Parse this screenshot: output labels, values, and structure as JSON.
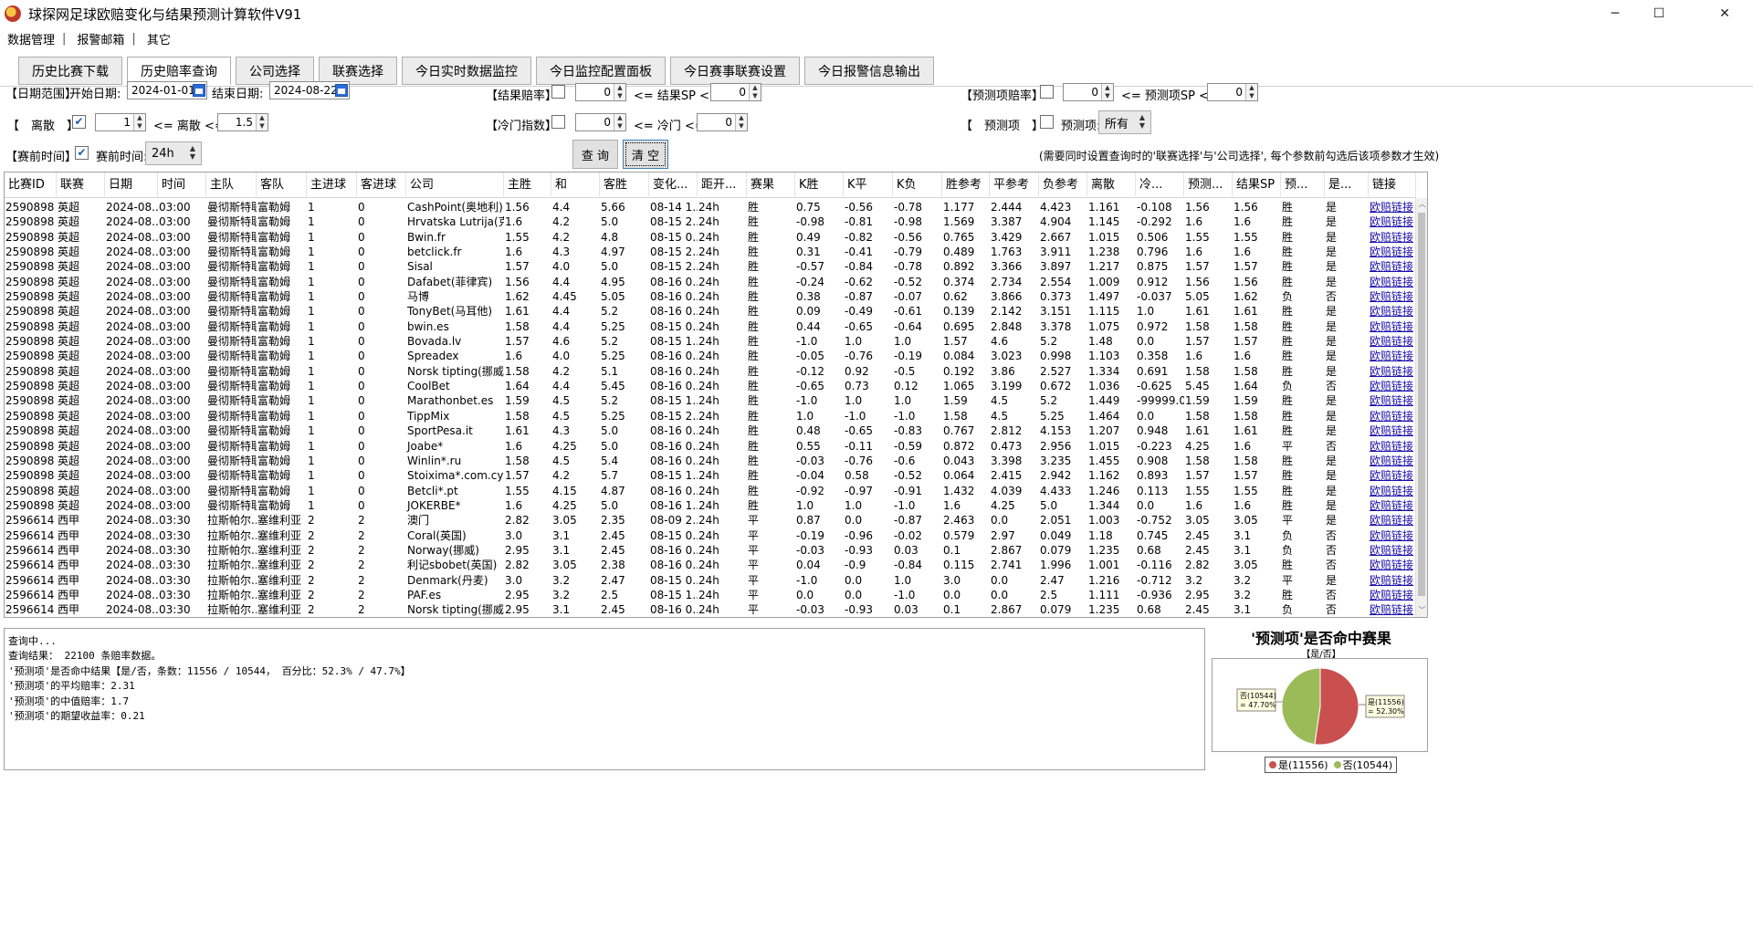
{
  "app": {
    "title": "球探网足球欧赔变化与结果预测计算软件V91",
    "min_glyph": "─",
    "max_glyph": "☐",
    "close_glyph": "✕"
  },
  "menu": {
    "items": [
      "数据管理",
      "报警邮箱",
      "其它"
    ],
    "separator": "|"
  },
  "tabs": [
    "历史比赛下载",
    "历史赔率查询",
    "公司选择",
    "联赛选择",
    "今日实时数据监控",
    "今日监控配置面板",
    "今日赛事联赛设置",
    "今日报警信息输出"
  ],
  "active_tab": 1,
  "filters": {
    "date_range_label": "【日期范围】",
    "start_label": "开始日期:",
    "start_value": "2024-01-01",
    "end_label": "结束日期:",
    "end_value": "2024-08-22",
    "disperse_label": "【　离散　】",
    "disperse_checked": true,
    "disperse_min": "1",
    "disperse_op": "<= 离散 <=",
    "disperse_max": "1.5",
    "pregame_label": "【赛前时间】",
    "pregame_checked": true,
    "pregame_time_label": "赛前时间:",
    "pregame_value": "24h",
    "result_odds_label": "【结果赔率】",
    "result_odds_min": "0",
    "result_odds_op": "<= 结果SP <=",
    "result_odds_max": "0",
    "cold_label": "【冷门指数】",
    "cold_min": "0",
    "cold_op": "<= 冷门 <=",
    "cold_max": "0",
    "pred_odds_label": "【预测项赔率】",
    "pred_odds_min": "0",
    "pred_odds_op": "<= 预测项SP <=",
    "pred_odds_max": "0",
    "pred_item_label": "【　预测项　】",
    "pred_item_text": "预测项:",
    "pred_item_value": "所有",
    "query_button": "查 询",
    "clear_button": "清 空",
    "note": "(需要同时设置查询时的'联赛选择'与'公司选择', 每个参数前勾选后该项参数才生效)"
  },
  "table": {
    "columns": [
      "比赛ID",
      "联赛",
      "日期",
      "时间",
      "主队",
      "客队",
      "主进球",
      "客进球",
      "公司",
      "主胜",
      "和",
      "客胜",
      "变化...",
      "距开...",
      "赛果",
      "K胜",
      "K平",
      "K负",
      "胜参考",
      "平参考",
      "负参考",
      "离散",
      "冷...",
      "预测...",
      "结果SP",
      "预...",
      "是...",
      "链接"
    ],
    "rows": [
      [
        "2590898",
        "英超",
        "2024-08...",
        "03:00",
        "曼彻斯特联",
        "富勒姆",
        "1",
        "0",
        "CashPoint(奥地利)",
        "1.56",
        "4.4",
        "5.66",
        "08-14 1...",
        "24h",
        "胜",
        "0.75",
        "-0.56",
        "-0.78",
        "1.177",
        "2.444",
        "4.423",
        "1.161",
        "-0.108",
        "1.56",
        "1.56",
        "胜",
        "是",
        "欧赔链接"
      ],
      [
        "2590898",
        "英超",
        "2024-08...",
        "03:00",
        "曼彻斯特联",
        "富勒姆",
        "1",
        "0",
        "Hrvatska Lutrija(克...",
        "1.6",
        "4.2",
        "5.0",
        "08-15 2...",
        "24h",
        "胜",
        "-0.98",
        "-0.81",
        "-0.98",
        "1.569",
        "3.387",
        "4.904",
        "1.145",
        "-0.292",
        "1.6",
        "1.6",
        "胜",
        "是",
        "欧赔链接"
      ],
      [
        "2590898",
        "英超",
        "2024-08...",
        "03:00",
        "曼彻斯特联",
        "富勒姆",
        "1",
        "0",
        "Bwin.fr",
        "1.55",
        "4.2",
        "4.8",
        "08-15 0...",
        "24h",
        "胜",
        "0.49",
        "-0.82",
        "-0.56",
        "0.765",
        "3.429",
        "2.667",
        "1.015",
        "0.506",
        "1.55",
        "1.55",
        "胜",
        "是",
        "欧赔链接"
      ],
      [
        "2590898",
        "英超",
        "2024-08...",
        "03:00",
        "曼彻斯特联",
        "富勒姆",
        "1",
        "0",
        "betclick.fr",
        "1.6",
        "4.3",
        "4.97",
        "08-15 2...",
        "24h",
        "胜",
        "0.31",
        "-0.41",
        "-0.79",
        "0.489",
        "1.763",
        "3.911",
        "1.238",
        "0.796",
        "1.6",
        "1.6",
        "胜",
        "是",
        "欧赔链接"
      ],
      [
        "2590898",
        "英超",
        "2024-08...",
        "03:00",
        "曼彻斯特联",
        "富勒姆",
        "1",
        "0",
        "Sisal",
        "1.57",
        "4.0",
        "5.0",
        "08-15 2...",
        "24h",
        "胜",
        "-0.57",
        "-0.84",
        "-0.78",
        "0.892",
        "3.366",
        "3.897",
        "1.217",
        "0.875",
        "1.57",
        "1.57",
        "胜",
        "是",
        "欧赔链接"
      ],
      [
        "2590898",
        "英超",
        "2024-08...",
        "03:00",
        "曼彻斯特联",
        "富勒姆",
        "1",
        "0",
        "Dafabet(菲律宾)",
        "1.56",
        "4.4",
        "4.95",
        "08-16 0...",
        "24h",
        "胜",
        "-0.24",
        "-0.62",
        "-0.52",
        "0.374",
        "2.734",
        "2.554",
        "1.009",
        "0.912",
        "1.56",
        "1.56",
        "胜",
        "是",
        "欧赔链接"
      ],
      [
        "2590898",
        "英超",
        "2024-08...",
        "03:00",
        "曼彻斯特联",
        "富勒姆",
        "1",
        "0",
        "马博",
        "1.62",
        "4.45",
        "5.05",
        "08-16 0...",
        "24h",
        "胜",
        "0.38",
        "-0.87",
        "-0.07",
        "0.62",
        "3.866",
        "0.373",
        "1.497",
        "-0.037",
        "5.05",
        "1.62",
        "负",
        "否",
        "欧赔链接"
      ],
      [
        "2590898",
        "英超",
        "2024-08...",
        "03:00",
        "曼彻斯特联",
        "富勒姆",
        "1",
        "0",
        "TonyBet(马耳他)",
        "1.61",
        "4.4",
        "5.2",
        "08-16 0...",
        "24h",
        "胜",
        "0.09",
        "-0.49",
        "-0.61",
        "0.139",
        "2.142",
        "3.151",
        "1.115",
        "1.0",
        "1.61",
        "1.61",
        "胜",
        "是",
        "欧赔链接"
      ],
      [
        "2590898",
        "英超",
        "2024-08...",
        "03:00",
        "曼彻斯特联",
        "富勒姆",
        "1",
        "0",
        "bwin.es",
        "1.58",
        "4.4",
        "5.25",
        "08-15 0...",
        "24h",
        "胜",
        "0.44",
        "-0.65",
        "-0.64",
        "0.695",
        "2.848",
        "3.378",
        "1.075",
        "0.972",
        "1.58",
        "1.58",
        "胜",
        "是",
        "欧赔链接"
      ],
      [
        "2590898",
        "英超",
        "2024-08...",
        "03:00",
        "曼彻斯特联",
        "富勒姆",
        "1",
        "0",
        "Bovada.lv",
        "1.57",
        "4.6",
        "5.2",
        "08-15 1...",
        "24h",
        "胜",
        "-1.0",
        "1.0",
        "1.0",
        "1.57",
        "4.6",
        "5.2",
        "1.48",
        "0.0",
        "1.57",
        "1.57",
        "胜",
        "是",
        "欧赔链接"
      ],
      [
        "2590898",
        "英超",
        "2024-08...",
        "03:00",
        "曼彻斯特联",
        "富勒姆",
        "1",
        "0",
        "Spreadex",
        "1.6",
        "4.0",
        "5.25",
        "08-16 0...",
        "24h",
        "胜",
        "-0.05",
        "-0.76",
        "-0.19",
        "0.084",
        "3.023",
        "0.998",
        "1.103",
        "0.358",
        "1.6",
        "1.6",
        "胜",
        "是",
        "欧赔链接"
      ],
      [
        "2590898",
        "英超",
        "2024-08...",
        "03:00",
        "曼彻斯特联",
        "富勒姆",
        "1",
        "0",
        "Norsk tipting(挪威)",
        "1.58",
        "4.2",
        "5.1",
        "08-16 0...",
        "24h",
        "胜",
        "-0.12",
        "0.92",
        "-0.5",
        "0.192",
        "3.86",
        "2.527",
        "1.334",
        "0.691",
        "1.58",
        "1.58",
        "胜",
        "是",
        "欧赔链接"
      ],
      [
        "2590898",
        "英超",
        "2024-08...",
        "03:00",
        "曼彻斯特联",
        "富勒姆",
        "1",
        "0",
        "CoolBet",
        "1.64",
        "4.4",
        "5.45",
        "08-16 0...",
        "24h",
        "胜",
        "-0.65",
        "0.73",
        "0.12",
        "1.065",
        "3.199",
        "0.672",
        "1.036",
        "-0.625",
        "5.45",
        "1.64",
        "负",
        "否",
        "欧赔链接"
      ],
      [
        "2590898",
        "英超",
        "2024-08...",
        "03:00",
        "曼彻斯特联",
        "富勒姆",
        "1",
        "0",
        "Marathonbet.es",
        "1.59",
        "4.5",
        "5.2",
        "08-15 1...",
        "24h",
        "胜",
        "-1.0",
        "1.0",
        "1.0",
        "1.59",
        "4.5",
        "5.2",
        "1.449",
        "-99999.0",
        "1.59",
        "1.59",
        "胜",
        "是",
        "欧赔链接"
      ],
      [
        "2590898",
        "英超",
        "2024-08...",
        "03:00",
        "曼彻斯特联",
        "富勒姆",
        "1",
        "0",
        "TippMix",
        "1.58",
        "4.5",
        "5.25",
        "08-15 2...",
        "24h",
        "胜",
        "1.0",
        "-1.0",
        "-1.0",
        "1.58",
        "4.5",
        "5.25",
        "1.464",
        "0.0",
        "1.58",
        "1.58",
        "胜",
        "是",
        "欧赔链接"
      ],
      [
        "2590898",
        "英超",
        "2024-08...",
        "03:00",
        "曼彻斯特联",
        "富勒姆",
        "1",
        "0",
        "SportPesa.it",
        "1.61",
        "4.3",
        "5.0",
        "08-16 0...",
        "24h",
        "胜",
        "0.48",
        "-0.65",
        "-0.83",
        "0.767",
        "2.812",
        "4.153",
        "1.207",
        "0.948",
        "1.61",
        "1.61",
        "胜",
        "是",
        "欧赔链接"
      ],
      [
        "2590898",
        "英超",
        "2024-08...",
        "03:00",
        "曼彻斯特联",
        "富勒姆",
        "1",
        "0",
        "Joabe*",
        "1.6",
        "4.25",
        "5.0",
        "08-16 0...",
        "24h",
        "胜",
        "0.55",
        "-0.11",
        "-0.59",
        "0.872",
        "0.473",
        "2.956",
        "1.015",
        "-0.223",
        "4.25",
        "1.6",
        "平",
        "否",
        "欧赔链接"
      ],
      [
        "2590898",
        "英超",
        "2024-08...",
        "03:00",
        "曼彻斯特联",
        "富勒姆",
        "1",
        "0",
        "Winlin*.ru",
        "1.58",
        "4.5",
        "5.4",
        "08-16 0...",
        "24h",
        "胜",
        "-0.03",
        "-0.76",
        "-0.6",
        "0.043",
        "3.398",
        "3.235",
        "1.455",
        "0.908",
        "1.58",
        "1.58",
        "胜",
        "是",
        "欧赔链接"
      ],
      [
        "2590898",
        "英超",
        "2024-08...",
        "03:00",
        "曼彻斯特联",
        "富勒姆",
        "1",
        "0",
        "Stoixima*.com.cy",
        "1.57",
        "4.2",
        "5.7",
        "08-15 1...",
        "24h",
        "胜",
        "-0.04",
        "0.58",
        "-0.52",
        "0.064",
        "2.415",
        "2.942",
        "1.162",
        "0.893",
        "1.57",
        "1.57",
        "胜",
        "是",
        "欧赔链接"
      ],
      [
        "2590898",
        "英超",
        "2024-08...",
        "03:00",
        "曼彻斯特联",
        "富勒姆",
        "1",
        "0",
        "Betcli*.pt",
        "1.55",
        "4.15",
        "4.87",
        "08-16 0...",
        "24h",
        "胜",
        "-0.92",
        "-0.97",
        "-0.91",
        "1.432",
        "4.039",
        "4.433",
        "1.246",
        "0.113",
        "1.55",
        "1.55",
        "胜",
        "是",
        "欧赔链接"
      ],
      [
        "2590898",
        "英超",
        "2024-08...",
        "03:00",
        "曼彻斯特联",
        "富勒姆",
        "1",
        "0",
        "JOKERBE*",
        "1.6",
        "4.25",
        "5.0",
        "08-16 1...",
        "24h",
        "胜",
        "1.0",
        "1.0",
        "-1.0",
        "1.6",
        "4.25",
        "5.0",
        "1.344",
        "0.0",
        "1.6",
        "1.6",
        "胜",
        "是",
        "欧赔链接"
      ],
      [
        "2596614",
        "西甲",
        "2024-08...",
        "03:30",
        "拉斯帕尔...",
        "塞维利亚",
        "2",
        "2",
        "澳门",
        "2.82",
        "3.05",
        "2.35",
        "08-09 2...",
        "24h",
        "平",
        "0.87",
        "0.0",
        "-0.87",
        "2.463",
        "0.0",
        "2.051",
        "1.003",
        "-0.752",
        "3.05",
        "3.05",
        "平",
        "是",
        "欧赔链接"
      ],
      [
        "2596614",
        "西甲",
        "2024-08...",
        "03:30",
        "拉斯帕尔...",
        "塞维利亚",
        "2",
        "2",
        "Coral(英国)",
        "3.0",
        "3.1",
        "2.45",
        "08-15 0...",
        "24h",
        "平",
        "-0.19",
        "-0.96",
        "-0.02",
        "0.579",
        "2.97",
        "0.049",
        "1.18",
        "0.745",
        "2.45",
        "3.1",
        "负",
        "否",
        "欧赔链接"
      ],
      [
        "2596614",
        "西甲",
        "2024-08...",
        "03:30",
        "拉斯帕尔...",
        "塞维利亚",
        "2",
        "2",
        "Norway(挪威)",
        "2.95",
        "3.1",
        "2.45",
        "08-16 0...",
        "24h",
        "平",
        "-0.03",
        "-0.93",
        "0.03",
        "0.1",
        "2.867",
        "0.079",
        "1.235",
        "0.68",
        "2.45",
        "3.1",
        "负",
        "否",
        "欧赔链接"
      ],
      [
        "2596614",
        "西甲",
        "2024-08...",
        "03:30",
        "拉斯帕尔...",
        "塞维利亚",
        "2",
        "2",
        "利记sbobet(英国)",
        "2.82",
        "3.05",
        "2.38",
        "08-16 0...",
        "24h",
        "平",
        "0.04",
        "-0.9",
        "-0.84",
        "0.115",
        "2.741",
        "1.996",
        "1.001",
        "-0.116",
        "2.82",
        "3.05",
        "胜",
        "否",
        "欧赔链接"
      ],
      [
        "2596614",
        "西甲",
        "2024-08...",
        "03:30",
        "拉斯帕尔...",
        "塞维利亚",
        "2",
        "2",
        "Denmark(丹麦)",
        "3.0",
        "3.2",
        "2.47",
        "08-15 0...",
        "24h",
        "平",
        "-1.0",
        "0.0",
        "1.0",
        "3.0",
        "0.0",
        "2.47",
        "1.216",
        "-0.712",
        "3.2",
        "3.2",
        "平",
        "是",
        "欧赔链接"
      ],
      [
        "2596614",
        "西甲",
        "2024-08...",
        "03:30",
        "拉斯帕尔...",
        "塞维利亚",
        "2",
        "2",
        "PAF.es",
        "2.95",
        "3.2",
        "2.5",
        "08-15 1...",
        "24h",
        "平",
        "0.0",
        "0.0",
        "-1.0",
        "0.0",
        "0.0",
        "2.5",
        "1.111",
        "-0.936",
        "2.95",
        "3.2",
        "胜",
        "否",
        "欧赔链接"
      ],
      [
        "2596614",
        "西甲",
        "2024-08...",
        "03:30",
        "拉斯帕尔...",
        "塞维利亚",
        "2",
        "2",
        "Norsk tipting(挪威)",
        "2.95",
        "3.1",
        "2.45",
        "08-16 0...",
        "24h",
        "平",
        "-0.03",
        "-0.93",
        "0.03",
        "0.1",
        "2.867",
        "0.079",
        "1.235",
        "0.68",
        "2.45",
        "3.1",
        "负",
        "否",
        "欧赔链接"
      ]
    ]
  },
  "log": [
    "查询中...",
    "查询结果： 22100 条赔率数据。",
    "'预测项'是否命中结果【是/否，条数：11556 / 10544， 百分比：52.3% / 47.7%】",
    "'预测项'的平均赔率：2.31",
    "'预测项'的中值赔率：1.7",
    "'预测项'的期望收益率：0.21"
  ],
  "pie": {
    "title": "'预测项'是否命中赛果",
    "subtitle": "【是/否】",
    "yes_label": "是(11556)",
    "yes_pct": "= 52.30%",
    "no_label": "否(10544)",
    "no_pct": "= 47.70%",
    "legend_yes": "是(11556)",
    "legend_no": "否(10544)",
    "yes_fraction": 0.523,
    "yes_color": "#c9504f",
    "no_color": "#9bbb59"
  }
}
